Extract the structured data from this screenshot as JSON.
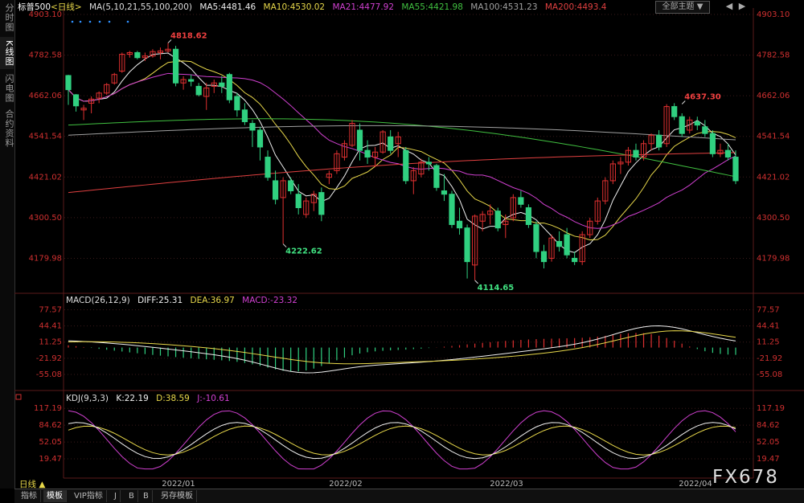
{
  "sidebar": {
    "tabs": [
      {
        "label": "分时图",
        "active": false
      },
      {
        "label": "K线图",
        "active": true
      },
      {
        "label": "闪电图",
        "active": false
      },
      {
        "label": "合约资料",
        "active": false
      }
    ]
  },
  "header": {
    "symbol": "标普500",
    "period": "<日线>",
    "ma_title": "MA(5,10,21,55,100,200)",
    "ma_values": [
      {
        "text": "MA5:4481.46",
        "color": "#f0f0f0"
      },
      {
        "text": "MA10:4530.02",
        "color": "#e8d84a"
      },
      {
        "text": "MA21:4477.92",
        "color": "#d040d0"
      },
      {
        "text": "MA55:4421.98",
        "color": "#40c040"
      },
      {
        "text": "MA100:4531.23",
        "color": "#a0a0a0"
      },
      {
        "text": "MA200:4493.4",
        "color": "#e04040"
      }
    ],
    "theme_button": "全部主题",
    "theme_icon": "chevron-down-icon",
    "nav_icons": [
      "prev-arrow-icon",
      "next-arrow-icon"
    ]
  },
  "macd_header": {
    "title": "MACD(26,12,9)",
    "diff": "DIFF:25.31",
    "dea": "DEA:36.97",
    "macd": "MACD:-23.32"
  },
  "kdj_header": {
    "title": "KDJ(9,3,3)",
    "k": "K:22.19",
    "d": "D:38.59",
    "j": "J:-10.61"
  },
  "bottom_bar": {
    "period_label": "日线 ▲",
    "tabs": [
      {
        "label": "指标",
        "active": false
      },
      {
        "label": "模板",
        "active": true
      },
      {
        "label": "VIP指标",
        "active": false
      },
      {
        "label": "J",
        "active": false
      },
      {
        "label": "B",
        "active": false
      },
      {
        "label": "B",
        "active": false
      },
      {
        "label": "另存模板",
        "active": false
      }
    ]
  },
  "watermark": "FX678",
  "colors": {
    "up": "#e03030",
    "down": "#30d080",
    "axis": "#d03030",
    "grid": "#3a1a1a"
  },
  "chart_data": [
    {
      "type": "candlestick",
      "title": "标普500",
      "ylim": [
        4100,
        4903.1
      ],
      "y_ticks": [
        "4903.10",
        "4782.58",
        "4662.06",
        "4541.54",
        "4421.02",
        "4300.50",
        "4179.98"
      ],
      "x_ticks": [
        "2022/01",
        "2022/02",
        "2022/03",
        "2022/04"
      ],
      "annotations": [
        "4818.62",
        "4637.30",
        "4222.62",
        "4114.65"
      ],
      "candles_ohlc": [
        [
          4722,
          4724,
          4635,
          4680
        ],
        [
          4665,
          4667,
          4615,
          4632
        ],
        [
          4620,
          4635,
          4590,
          4625
        ],
        [
          4640,
          4660,
          4610,
          4652
        ],
        [
          4655,
          4675,
          4640,
          4670
        ],
        [
          4670,
          4700,
          4665,
          4695
        ],
        [
          4700,
          4730,
          4695,
          4725
        ],
        [
          4735,
          4790,
          4730,
          4785
        ],
        [
          4785,
          4795,
          4775,
          4790
        ],
        [
          4790,
          4795,
          4770,
          4775
        ],
        [
          4775,
          4790,
          4765,
          4780
        ],
        [
          4780,
          4800,
          4775,
          4793
        ],
        [
          4790,
          4805,
          4770,
          4795
        ],
        [
          4795,
          4819,
          4790,
          4800
        ],
        [
          4800,
          4810,
          4690,
          4700
        ],
        [
          4700,
          4720,
          4680,
          4710
        ],
        [
          4710,
          4725,
          4690,
          4705
        ],
        [
          4690,
          4700,
          4660,
          4665
        ],
        [
          4660,
          4700,
          4620,
          4685
        ],
        [
          4690,
          4710,
          4670,
          4700
        ],
        [
          4700,
          4720,
          4670,
          4690
        ],
        [
          4725,
          4730,
          4640,
          4650
        ],
        [
          4660,
          4670,
          4600,
          4620
        ],
        [
          4620,
          4640,
          4575,
          4585
        ],
        [
          4580,
          4590,
          4510,
          4560
        ],
        [
          4560,
          4570,
          4470,
          4510
        ],
        [
          4480,
          4500,
          4410,
          4420
        ],
        [
          4410,
          4440,
          4340,
          4355
        ],
        [
          4360,
          4420,
          4223,
          4410
        ],
        [
          4410,
          4420,
          4370,
          4380
        ],
        [
          4370,
          4400,
          4310,
          4330
        ],
        [
          4310,
          4360,
          4300,
          4350
        ],
        [
          4345,
          4380,
          4320,
          4370
        ],
        [
          4375,
          4390,
          4290,
          4310
        ],
        [
          4420,
          4440,
          4400,
          4430
        ],
        [
          4440,
          4500,
          4430,
          4490
        ],
        [
          4480,
          4530,
          4470,
          4520
        ],
        [
          4515,
          4590,
          4510,
          4580
        ],
        [
          4560,
          4580,
          4470,
          4500
        ],
        [
          4500,
          4530,
          4460,
          4480
        ],
        [
          4480,
          4510,
          4450,
          4495
        ],
        [
          4495,
          4560,
          4490,
          4555
        ],
        [
          4540,
          4560,
          4490,
          4500
        ],
        [
          4520,
          4555,
          4480,
          4540
        ],
        [
          4500,
          4510,
          4400,
          4410
        ],
        [
          4410,
          4450,
          4370,
          4440
        ],
        [
          4430,
          4475,
          4420,
          4465
        ],
        [
          4465,
          4480,
          4440,
          4460
        ],
        [
          4455,
          4460,
          4380,
          4390
        ],
        [
          4380,
          4430,
          4350,
          4370
        ],
        [
          4370,
          4380,
          4270,
          4280
        ],
        [
          4290,
          4330,
          4250,
          4270
        ],
        [
          4270,
          4280,
          4120,
          4170
        ],
        [
          4160,
          4310,
          4115,
          4305
        ],
        [
          4290,
          4320,
          4260,
          4310
        ],
        [
          4310,
          4340,
          4280,
          4320
        ],
        [
          4320,
          4330,
          4260,
          4270
        ],
        [
          4280,
          4310,
          4240,
          4290
        ],
        [
          4300,
          4370,
          4290,
          4360
        ],
        [
          4360,
          4380,
          4330,
          4340
        ],
        [
          4330,
          4340,
          4270,
          4280
        ],
        [
          4280,
          4290,
          4180,
          4200
        ],
        [
          4200,
          4220,
          4150,
          4170
        ],
        [
          4180,
          4250,
          4170,
          4240
        ],
        [
          4230,
          4260,
          4200,
          4215
        ],
        [
          4250,
          4270,
          4180,
          4190
        ],
        [
          4180,
          4200,
          4160,
          4170
        ],
        [
          4170,
          4260,
          4160,
          4250
        ],
        [
          4250,
          4300,
          4240,
          4290
        ],
        [
          4290,
          4360,
          4280,
          4350
        ],
        [
          4350,
          4420,
          4340,
          4410
        ],
        [
          4410,
          4470,
          4400,
          4460
        ],
        [
          4460,
          4480,
          4430,
          4465
        ],
        [
          4465,
          4510,
          4455,
          4500
        ],
        [
          4500,
          4520,
          4470,
          4480
        ],
        [
          4480,
          4530,
          4470,
          4520
        ],
        [
          4520,
          4550,
          4500,
          4545
        ],
        [
          4545,
          4560,
          4500,
          4510
        ],
        [
          4520,
          4637,
          4510,
          4630
        ],
        [
          4630,
          4640,
          4590,
          4600
        ],
        [
          4600,
          4610,
          4540,
          4550
        ],
        [
          4560,
          4600,
          4550,
          4590
        ],
        [
          4585,
          4600,
          4560,
          4575
        ],
        [
          4570,
          4590,
          4540,
          4550
        ],
        [
          4550,
          4560,
          4480,
          4490
        ],
        [
          4490,
          4520,
          4480,
          4500
        ],
        [
          4500,
          4520,
          4470,
          4480
        ],
        [
          4480,
          4500,
          4400,
          4410
        ]
      ]
    },
    {
      "type": "histogram+line",
      "title": "MACD(26,12,9)",
      "ylim": [
        -70,
        90
      ],
      "y_ticks": [
        "77.57",
        "44.41",
        "11.25",
        "-21.92",
        "-55.08"
      ]
    },
    {
      "type": "line",
      "title": "KDJ(9,3,3)",
      "ylim": [
        -10,
        130
      ],
      "y_ticks": [
        "117.19",
        "84.62",
        "52.05",
        "19.47"
      ]
    }
  ]
}
